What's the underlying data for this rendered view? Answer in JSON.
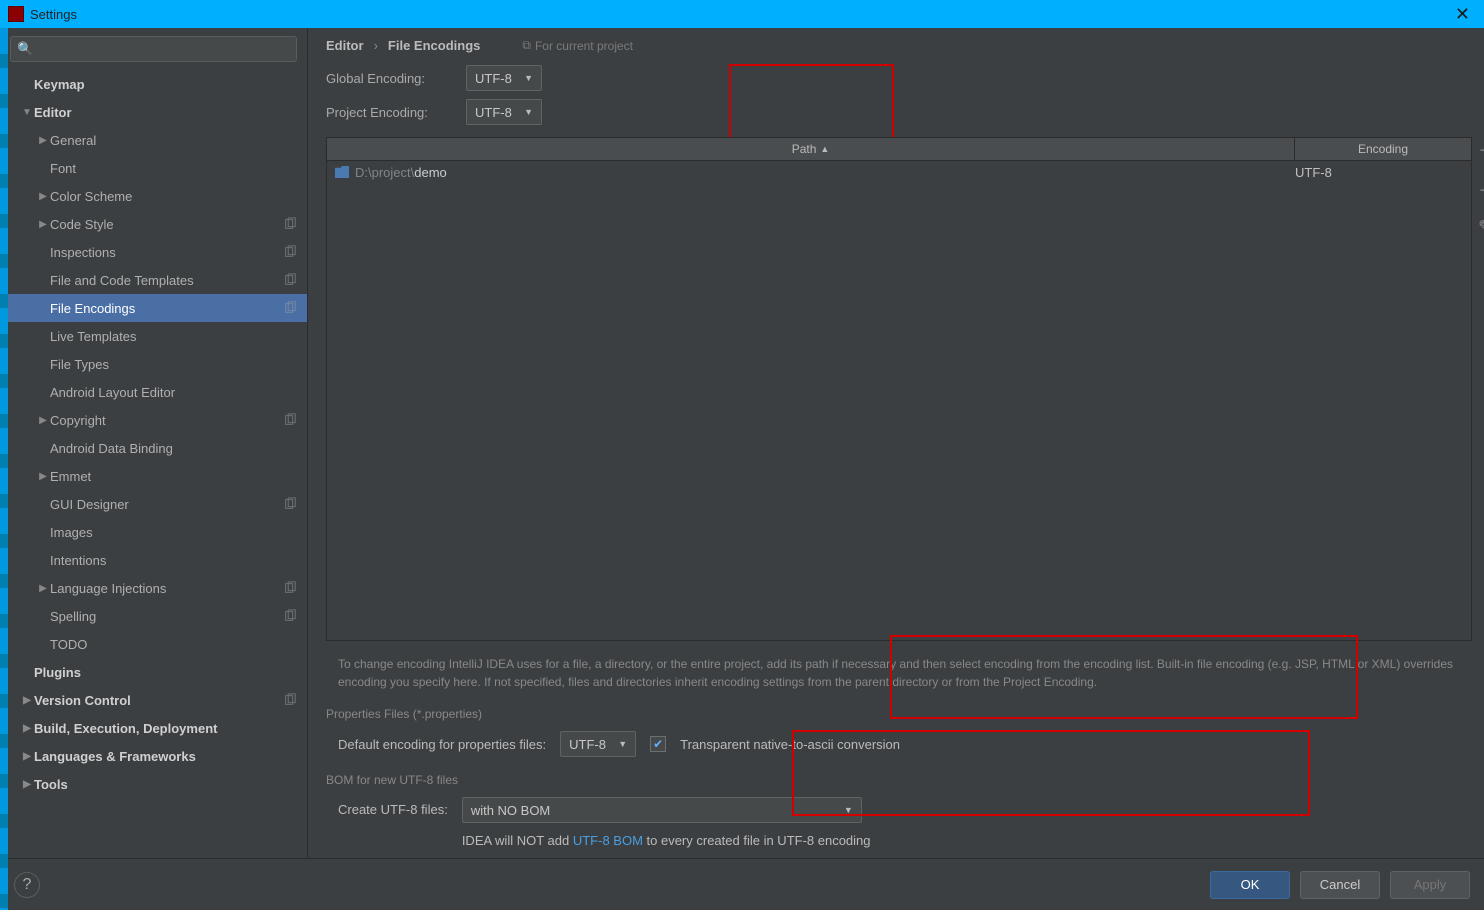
{
  "window": {
    "title": "Settings"
  },
  "sidebar": {
    "search": {
      "placeholder": ""
    },
    "items": [
      {
        "label": "Keymap",
        "bold": true,
        "indent": 0,
        "caret": ""
      },
      {
        "label": "Editor",
        "bold": true,
        "indent": 0,
        "caret": "open"
      },
      {
        "label": "General",
        "indent": 1,
        "caret": "right"
      },
      {
        "label": "Font",
        "indent": 1,
        "caret": ""
      },
      {
        "label": "Color Scheme",
        "indent": 1,
        "caret": "right"
      },
      {
        "label": "Code Style",
        "indent": 1,
        "caret": "right",
        "badge": true
      },
      {
        "label": "Inspections",
        "indent": 1,
        "caret": "",
        "badge": true
      },
      {
        "label": "File and Code Templates",
        "indent": 1,
        "caret": "",
        "badge": true
      },
      {
        "label": "File Encodings",
        "indent": 1,
        "caret": "",
        "badge": true,
        "selected": true
      },
      {
        "label": "Live Templates",
        "indent": 1,
        "caret": ""
      },
      {
        "label": "File Types",
        "indent": 1,
        "caret": ""
      },
      {
        "label": "Android Layout Editor",
        "indent": 1,
        "caret": ""
      },
      {
        "label": "Copyright",
        "indent": 1,
        "caret": "right",
        "badge": true
      },
      {
        "label": "Android Data Binding",
        "indent": 1,
        "caret": ""
      },
      {
        "label": "Emmet",
        "indent": 1,
        "caret": "right"
      },
      {
        "label": "GUI Designer",
        "indent": 1,
        "caret": "",
        "badge": true
      },
      {
        "label": "Images",
        "indent": 1,
        "caret": ""
      },
      {
        "label": "Intentions",
        "indent": 1,
        "caret": ""
      },
      {
        "label": "Language Injections",
        "indent": 1,
        "caret": "right",
        "badge": true
      },
      {
        "label": "Spelling",
        "indent": 1,
        "caret": "",
        "badge": true
      },
      {
        "label": "TODO",
        "indent": 1,
        "caret": ""
      },
      {
        "label": "Plugins",
        "bold": true,
        "indent": 0,
        "caret": ""
      },
      {
        "label": "Version Control",
        "bold": true,
        "indent": 0,
        "caret": "right",
        "badge": true
      },
      {
        "label": "Build, Execution, Deployment",
        "bold": true,
        "indent": 0,
        "caret": "right"
      },
      {
        "label": "Languages & Frameworks",
        "bold": true,
        "indent": 0,
        "caret": "right"
      },
      {
        "label": "Tools",
        "bold": true,
        "indent": 0,
        "caret": "right"
      }
    ]
  },
  "main": {
    "breadcrumb": {
      "a": "Editor",
      "b": "File Encodings"
    },
    "scope_hint": "For current project",
    "global_encoding": {
      "label": "Global Encoding:",
      "value": "UTF-8"
    },
    "project_encoding": {
      "label": "Project Encoding:",
      "value": "UTF-8"
    },
    "columns": {
      "path": "Path",
      "encoding": "Encoding"
    },
    "row": {
      "prefix": "D:\\project\\",
      "demo": "demo",
      "encoding": "UTF-8"
    },
    "help_text": "To change encoding IntelliJ IDEA uses for a file, a directory, or the entire project, add its path if necessary and then select encoding from the encoding list. Built-in file encoding (e.g. JSP, HTML or XML) overrides encoding you specify here. If not specified, files and directories inherit encoding settings from the parent directory or from the Project Encoding.",
    "props_section": {
      "title": "Properties Files (*.properties)",
      "label": "Default encoding for properties files:",
      "value": "UTF-8",
      "checkbox_label": "Transparent native-to-ascii conversion",
      "checked": true
    },
    "bom_section": {
      "title": "BOM for new UTF-8 files",
      "label": "Create UTF-8 files:",
      "value": "with NO BOM",
      "note_a": "IDEA will NOT add ",
      "note_link": "UTF-8 BOM",
      "note_b": " to every created file in UTF-8 encoding"
    }
  },
  "footer": {
    "ok": "OK",
    "cancel": "Cancel",
    "apply": "Apply"
  }
}
